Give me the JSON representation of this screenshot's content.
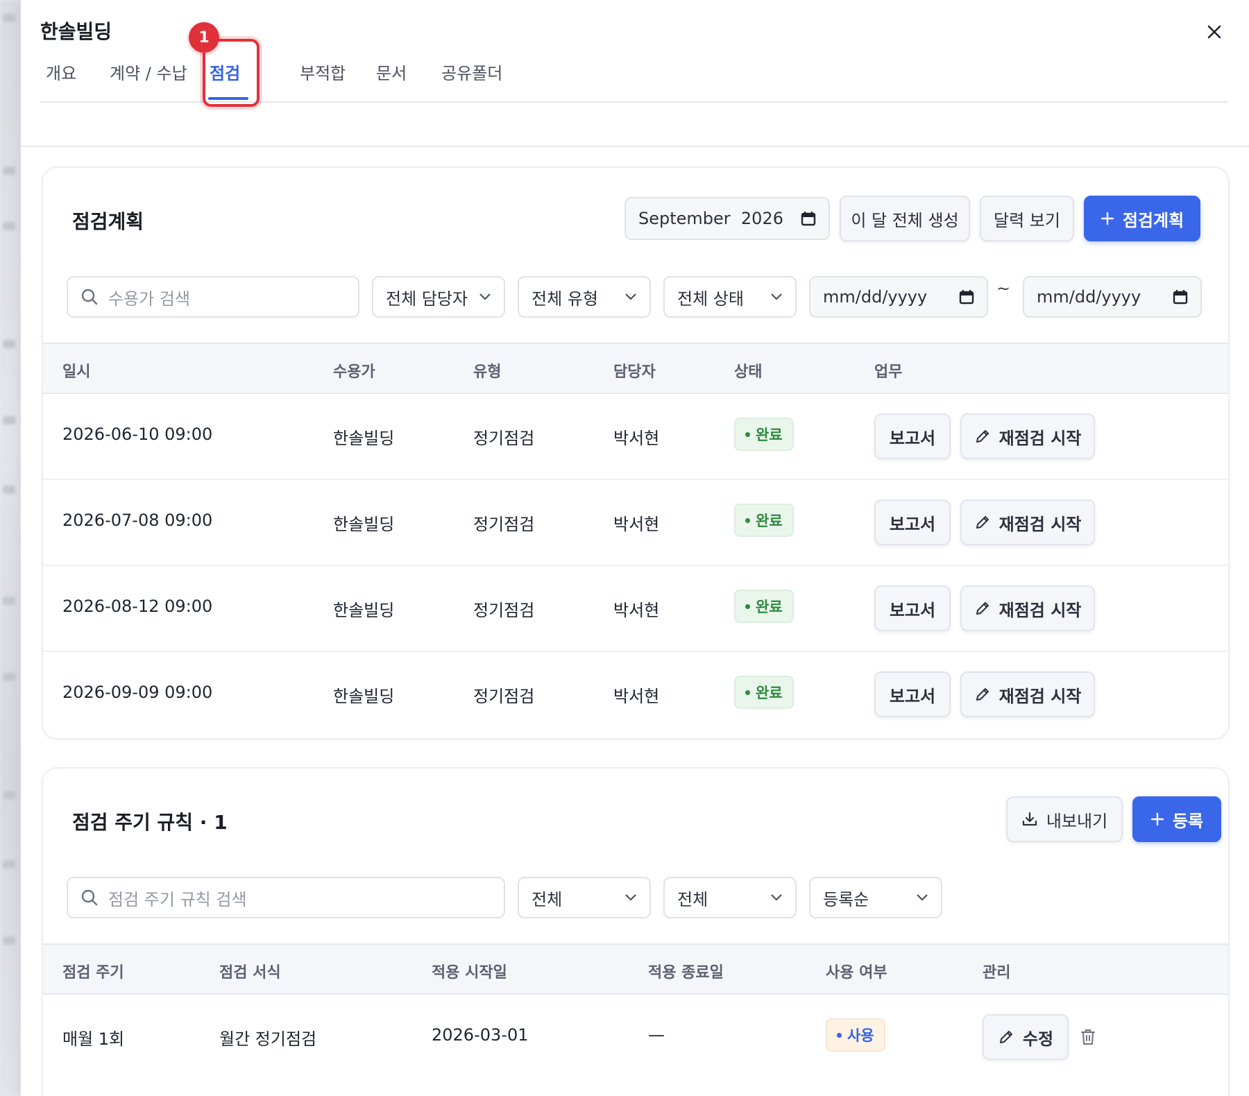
{
  "header": {
    "title": "한솔빌딩",
    "tabs": [
      {
        "label": "개요"
      },
      {
        "label": "계약 / 수납"
      },
      {
        "label": "점검"
      },
      {
        "label": "부적합"
      },
      {
        "label": "문서"
      },
      {
        "label": "공유폴더"
      }
    ],
    "active_tab": "점검",
    "tab_badge": "1"
  },
  "colors": {
    "accent": "#3a66ea",
    "highlight": "#e0303a",
    "done": "#2f8a3f"
  },
  "plan": {
    "title": "점검계획",
    "month_picker": "September  2026",
    "generate_label": "이 달 전체 생성",
    "calendar_label": "달력 보기",
    "add_label": "점검계획",
    "search_placeholder": "수용가 검색",
    "filters": {
      "manager": "전체 담당자",
      "type": "전체 유형",
      "status": "전체 상태",
      "date_from_placeholder": "mm/dd/yyyy",
      "date_to_placeholder": "mm/dd/yyyy",
      "range_sep": "~"
    },
    "columns": [
      "일시",
      "수용가",
      "유형",
      "담당자",
      "상태",
      "업무"
    ],
    "rows": [
      {
        "datetime": "2026-06-10 09:00",
        "customer": "한솔빌딩",
        "type": "정기점검",
        "manager": "박서현",
        "status": "완료",
        "report": "보고서",
        "reinspect": "재점검 시작"
      },
      {
        "datetime": "2026-07-08 09:00",
        "customer": "한솔빌딩",
        "type": "정기점검",
        "manager": "박서현",
        "status": "완료",
        "report": "보고서",
        "reinspect": "재점검 시작"
      },
      {
        "datetime": "2026-08-12 09:00",
        "customer": "한솔빌딩",
        "type": "정기점검",
        "manager": "박서현",
        "status": "완료",
        "report": "보고서",
        "reinspect": "재점검 시작"
      },
      {
        "datetime": "2026-09-09 09:00",
        "customer": "한솔빌딩",
        "type": "정기점검",
        "manager": "박서현",
        "status": "완료",
        "report": "보고서",
        "reinspect": "재점검 시작"
      }
    ]
  },
  "rules": {
    "title": "점검 주기 규칙 · 1",
    "export_label": "내보내기",
    "add_label": "등록",
    "search_placeholder": "점검 주기 규칙 검색",
    "filters": {
      "filter1": "전체",
      "filter2": "전체",
      "sort": "등록순"
    },
    "columns": [
      "점검 주기",
      "점검 서식",
      "적용 시작일",
      "적용 종료일",
      "사용 여부",
      "관리"
    ],
    "rows": [
      {
        "cycle": "매월 1회",
        "form": "월간 정기점검",
        "start": "2026-03-01",
        "end": "—",
        "use": "사용",
        "edit": "수정"
      }
    ]
  }
}
